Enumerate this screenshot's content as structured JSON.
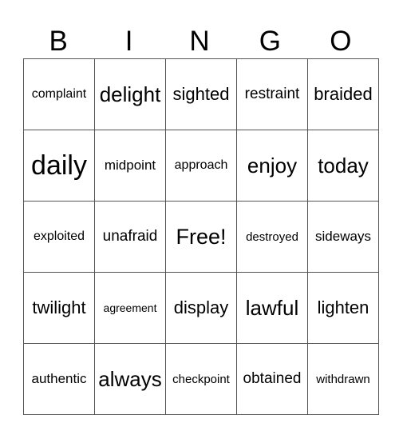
{
  "title_letters": [
    "B",
    "I",
    "N",
    "G",
    "O"
  ],
  "board": [
    [
      "complaint",
      "delight",
      "sighted",
      "restraint",
      "braided"
    ],
    [
      "daily",
      "midpoint",
      "approach",
      "enjoy",
      "today"
    ],
    [
      "exploited",
      "unafraid",
      "Free!",
      "destroyed",
      "sideways"
    ],
    [
      "twilight",
      "agreement",
      "display",
      "lawful",
      "lighten"
    ],
    [
      "authentic",
      "always",
      "checkpoint",
      "obtained",
      "withdrawn"
    ]
  ]
}
